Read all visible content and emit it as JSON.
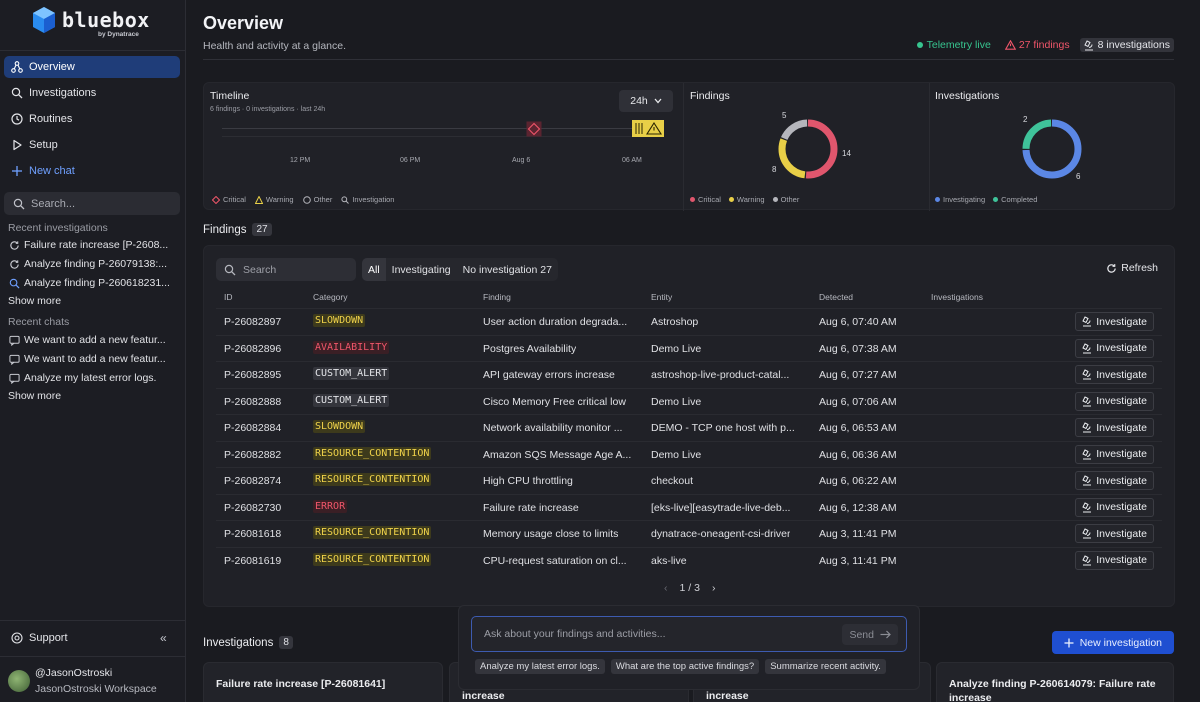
{
  "brand": {
    "name": "bluebox",
    "sub": "by Dynatrace",
    "accent": "#1f4fd1"
  },
  "sidebar": {
    "nav": [
      {
        "label": "Overview",
        "icon": "graph-icon",
        "active": true
      },
      {
        "label": "Investigations",
        "icon": "search-icon"
      },
      {
        "label": "Routines",
        "icon": "clock-icon"
      },
      {
        "label": "Setup",
        "icon": "play-icon"
      },
      {
        "label": "New chat",
        "icon": "plus-icon"
      }
    ],
    "search_placeholder": "Search...",
    "recent_investigations_label": "Recent investigations",
    "recent_investigations": [
      "Failure rate increase [P-2608...",
      "Analyze finding P-26079138:...",
      "Analyze finding P-260618231..."
    ],
    "show_more_1": "Show more",
    "recent_chats_label": "Recent chats",
    "recent_chats": [
      "We want to add a new featur...",
      "We want to add a new featur...",
      "Analyze my latest error logs."
    ],
    "show_more_2": "Show more",
    "support": "Support",
    "collapse": "«",
    "user": {
      "handle": "@JasonOstroski",
      "workspace": "JasonOstroski Workspace"
    }
  },
  "header": {
    "title": "Overview",
    "subtitle": "Health and activity at a glance.",
    "telemetry": "Telemetry live",
    "findings_badge": "27 findings",
    "investigations_badge": "8 investigations"
  },
  "timeline": {
    "title": "Timeline",
    "subtitle": "6 findings · 0 investigations · last 24h",
    "range": "24h",
    "ticks": [
      "12 PM",
      "06 PM",
      "Aug 6",
      "06 AM"
    ],
    "legend": [
      "Critical",
      "Warning",
      "Other",
      "Investigation"
    ]
  },
  "findings_chart": {
    "title": "Findings",
    "values": {
      "critical": 14,
      "warning": 8,
      "other": 5
    },
    "legend": [
      "Critical",
      "Warning",
      "Other"
    ],
    "colors": {
      "critical": "#e0566d",
      "warning": "#e8cf47",
      "other": "#b5b6bc"
    }
  },
  "investigations_chart": {
    "title": "Investigations",
    "values": {
      "investigating": 6,
      "completed": 2
    },
    "legend": [
      "Investigating",
      "Completed"
    ],
    "colors": {
      "investigating": "#5b87e5",
      "completed": "#3fc39a"
    }
  },
  "findings": {
    "title": "Findings",
    "count": "27",
    "search_placeholder": "Search",
    "tabs": [
      "All",
      "Investigating",
      "No investigation 27"
    ],
    "refresh": "Refresh",
    "columns": [
      "ID",
      "Category",
      "Finding",
      "Entity",
      "Detected",
      "Investigations"
    ],
    "rows": [
      {
        "id": "P-26082897",
        "category": "SLOWDOWN",
        "kind": "warn",
        "finding": "User action duration degrada...",
        "entity": "Astroshop",
        "detected": "Aug 6, 07:40 AM"
      },
      {
        "id": "P-26082896",
        "category": "AVAILABILITY",
        "kind": "err",
        "finding": "Postgres Availability",
        "entity": "Demo Live",
        "detected": "Aug 6, 07:38 AM"
      },
      {
        "id": "P-26082895",
        "category": "CUSTOM_ALERT",
        "kind": "neutral",
        "finding": "API gateway errors increase",
        "entity": "astroshop-live-product-catal...",
        "detected": "Aug 6, 07:27 AM"
      },
      {
        "id": "P-26082888",
        "category": "CUSTOM_ALERT",
        "kind": "neutral",
        "finding": "Cisco Memory Free critical low",
        "entity": "Demo Live",
        "detected": "Aug 6, 07:06 AM"
      },
      {
        "id": "P-26082884",
        "category": "SLOWDOWN",
        "kind": "warn",
        "finding": "Network availability monitor ...",
        "entity": "DEMO - TCP one host with p...",
        "detected": "Aug 6, 06:53 AM"
      },
      {
        "id": "P-26082882",
        "category": "RESOURCE_CONTENTION",
        "kind": "warn",
        "finding": "Amazon SQS Message Age A...",
        "entity": "Demo Live",
        "detected": "Aug 6, 06:36 AM"
      },
      {
        "id": "P-26082874",
        "category": "RESOURCE_CONTENTION",
        "kind": "warn",
        "finding": "High CPU throttling",
        "entity": "checkout",
        "detected": "Aug 6, 06:22 AM"
      },
      {
        "id": "P-26082730",
        "category": "ERROR",
        "kind": "err",
        "finding": "Failure rate increase",
        "entity": "[eks-live][easytrade-live-deb...",
        "detected": "Aug 6, 12:38 AM"
      },
      {
        "id": "P-26081618",
        "category": "RESOURCE_CONTENTION",
        "kind": "warn",
        "finding": "Memory usage close to limits",
        "entity": "dynatrace-oneagent-csi-driver",
        "detected": "Aug 3, 11:41 PM"
      },
      {
        "id": "P-26081619",
        "category": "RESOURCE_CONTENTION",
        "kind": "warn",
        "finding": "CPU-request saturation on cl...",
        "entity": "aks-live",
        "detected": "Aug 3, 11:41 PM"
      }
    ],
    "action_label": "Investigate",
    "pager": "1 / 3"
  },
  "investigations": {
    "title": "Investigations",
    "count": "8",
    "new_button": "New investigation",
    "cards": [
      "Failure rate increase [P-26081641]",
      "increase",
      "increase",
      "Analyze finding P-260614079: Failure rate increase"
    ]
  },
  "chat": {
    "placeholder": "Ask about your findings and activities...",
    "send": "Send",
    "suggestions": [
      "Analyze my latest error logs.",
      "What are the top active findings?",
      "Summarize recent activity."
    ]
  }
}
